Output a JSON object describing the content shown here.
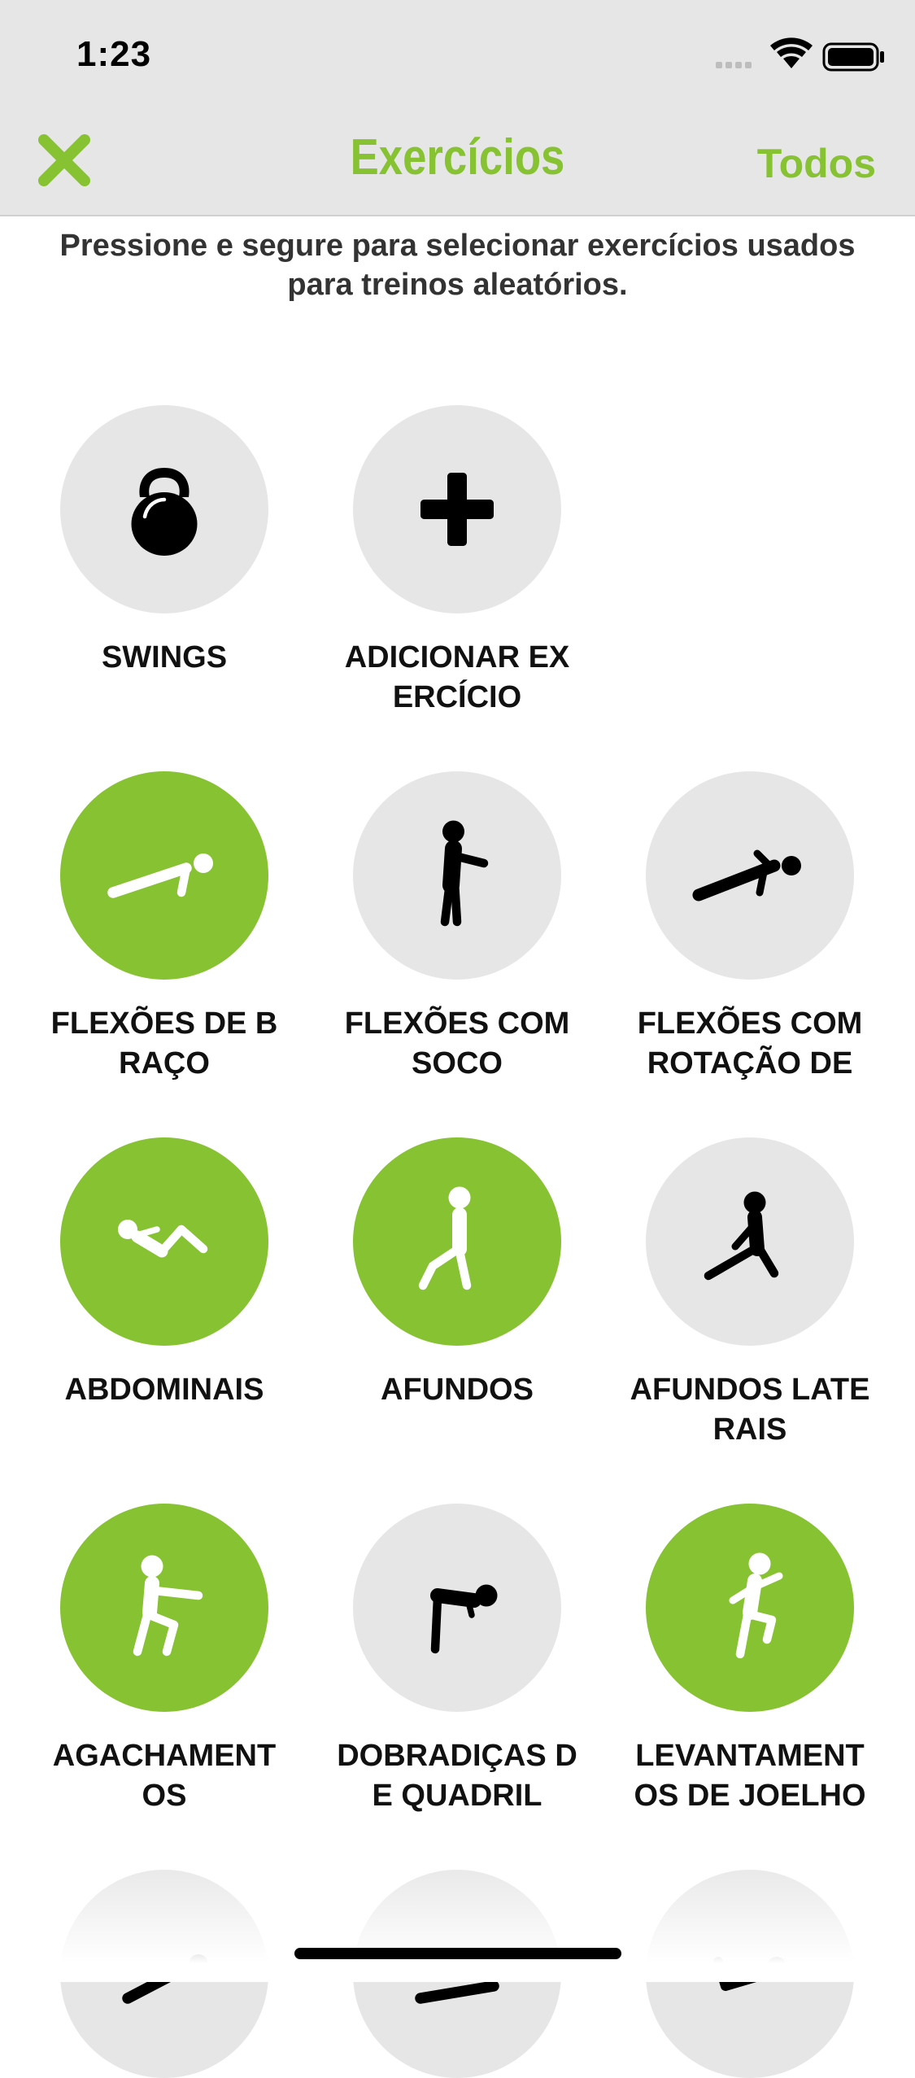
{
  "status": {
    "time": "1:23"
  },
  "nav": {
    "title": "Exercícios",
    "action_label": "Todos"
  },
  "instructions": "Pressione e segure para selecionar exercícios usados para treinos aleatórios.",
  "colors": {
    "accent": "#86c231",
    "tile_bg": "#e6e6e6",
    "bar_bg": "#e6e6e6"
  },
  "exercises": [
    {
      "label": "SWINGS",
      "icon": "kettlebell-icon",
      "selected": false
    },
    {
      "label": "ADICIONAR EXERCÍCIO",
      "icon": "plus-icon",
      "selected": false
    },
    {
      "label": "FLEXÕES DE BRAÇO",
      "icon": "push-up-icon",
      "selected": true
    },
    {
      "label": "FLEXÕES COM SOCO",
      "icon": "punch-icon",
      "selected": false
    },
    {
      "label": "FLEXÕES COM ROTAÇÃO DE",
      "icon": "rotation-push-up-icon",
      "selected": false
    },
    {
      "label": "ABDOMINAIS",
      "icon": "crunch-icon",
      "selected": true
    },
    {
      "label": "AFUNDOS",
      "icon": "lunge-icon",
      "selected": true
    },
    {
      "label": "AFUNDOS LATERAIS",
      "icon": "side-lunge-icon",
      "selected": false
    },
    {
      "label": "AGACHAMENTOS",
      "icon": "squat-icon",
      "selected": true
    },
    {
      "label": "DOBRADIÇAS DE QUADRIL",
      "icon": "hip-hinge-icon",
      "selected": false
    },
    {
      "label": "LEVANTAMENTOS DE JOELHO",
      "icon": "knee-raise-icon",
      "selected": true
    }
  ]
}
